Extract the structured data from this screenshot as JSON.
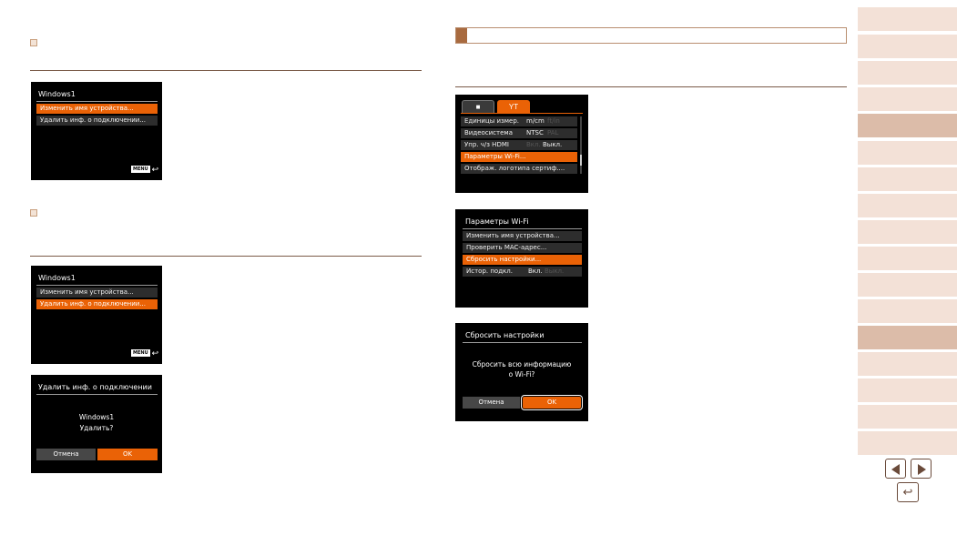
{
  "screen_rename": {
    "title": "Windows1",
    "items": [
      "Изменить имя устройства...",
      "Удалить инф. о подключении..."
    ],
    "menu_label": "MENU"
  },
  "screen_delete": {
    "title": "Windows1",
    "items": [
      "Изменить имя устройства...",
      "Удалить инф. о подключении..."
    ],
    "menu_label": "MENU"
  },
  "screen_delete_confirm": {
    "title": "Удалить инф. о подключении",
    "line1": "Windows1",
    "line2": "Удалить?",
    "cancel": "Отмена",
    "ok": "OK"
  },
  "screen_settings_menu": {
    "rows": [
      {
        "label": "Единицы измер.",
        "value": "m/cm",
        "dim": "ft/in"
      },
      {
        "label": "Видеосистема",
        "value": "NTSC",
        "dim": "PAL"
      },
      {
        "label": "Упр. ч/з HDMI",
        "value": "Вкл.",
        "value2": "Выкл."
      },
      {
        "label": "Параметры Wi-Fi...",
        "value": "",
        "dim": ""
      },
      {
        "label": "Отображ. логотипа сертиф....",
        "value": "",
        "dim": ""
      }
    ]
  },
  "screen_wifi_params": {
    "title": "Параметры Wi-Fi",
    "items": [
      "Изменить имя устройства...",
      "Проверить MAC-адрес...",
      "Сбросить настройки...",
      "Истор. подкл."
    ],
    "history_value": "Вкл.",
    "history_dim": "Выкл."
  },
  "screen_reset": {
    "title": "Сбросить настройки",
    "line1": "Сбросить всю информацию",
    "line2": "о Wi-Fi?",
    "cancel": "Отмена",
    "ok": "OK"
  },
  "colors": {
    "accent": "#ea6206",
    "sidebar": "#f3e1d7",
    "sidebar_active": "#dcbca9"
  },
  "icons": {
    "camera_tab": "camera-icon",
    "setup_tab": "wrench-icon",
    "prev": "arrow-left-icon",
    "next": "arrow-right-icon",
    "back": "return-icon"
  }
}
